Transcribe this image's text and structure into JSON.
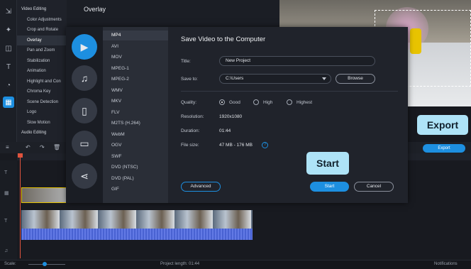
{
  "side_menu": {
    "items": [
      {
        "label": "Video Editing",
        "type": "head"
      },
      {
        "label": "Color Adjustments",
        "type": "item"
      },
      {
        "label": "Crop and Rotate",
        "type": "item"
      },
      {
        "label": "Overlay",
        "type": "selected"
      },
      {
        "label": "Pan and Zoom",
        "type": "item"
      },
      {
        "label": "Stabilization",
        "type": "item"
      },
      {
        "label": "Animation",
        "type": "item"
      },
      {
        "label": "Highlight and Con",
        "type": "item"
      },
      {
        "label": "Chroma Key",
        "type": "item"
      },
      {
        "label": "Scene Detection",
        "type": "item"
      },
      {
        "label": "Logo",
        "type": "item"
      },
      {
        "label": "Slow Motion",
        "type": "item"
      },
      {
        "label": "Audio Editing",
        "type": "head"
      }
    ]
  },
  "panel_title": "Overlay",
  "callouts": {
    "export": "Export",
    "start": "Start"
  },
  "export_button": "Export",
  "dialog": {
    "title": "Save Video to the Computer",
    "formats": [
      "MP4",
      "AVI",
      "MOV",
      "MPEG-1",
      "MPEG-2",
      "WMV",
      "MKV",
      "FLV",
      "M2TS (H.264)",
      "WebM",
      "OGV",
      "SWF",
      "DVD (NTSC)",
      "DVD (PAL)",
      "GIF"
    ],
    "selected_format": "MP4",
    "title_label": "Title:",
    "title_value": "New Project",
    "save_to_label": "Save to:",
    "save_to_value": "C:\\Users",
    "browse": "Browse",
    "quality_label": "Quality:",
    "quality_options": [
      "Good",
      "High",
      "Highest"
    ],
    "quality_selected": "Good",
    "resolution_label": "Resolution:",
    "resolution_value": "1920x1080",
    "duration_label": "Duration:",
    "duration_value": "01:44",
    "file_size_label": "File size:",
    "file_size_value": "47 MB - 176 MB",
    "help": "?",
    "advanced": "Advanced",
    "start": "Start",
    "cancel": "Cancel"
  },
  "status": {
    "scale_label": "Scale:",
    "project_length": "Project length:  01:44",
    "notifications": "Notifications"
  },
  "colors": {
    "accent": "#1d8fe0",
    "callout": "#aee3f7"
  }
}
